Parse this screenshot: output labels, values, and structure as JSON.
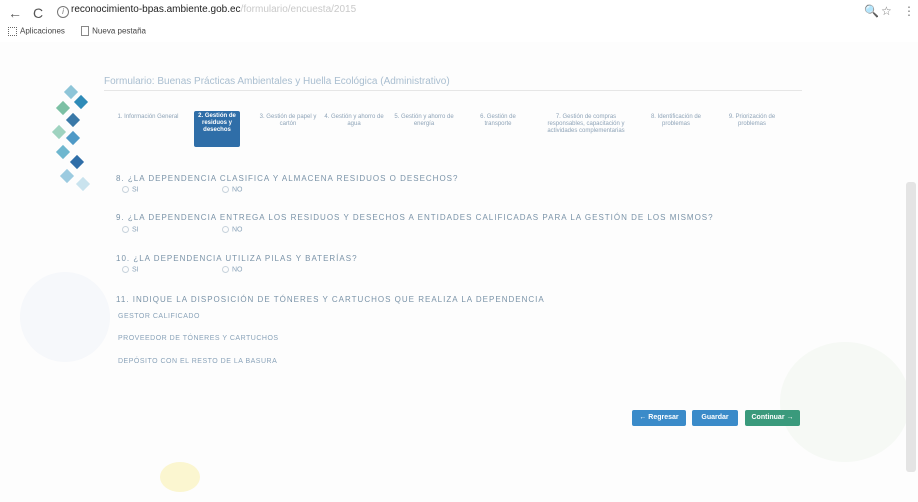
{
  "browser": {
    "url_host": "reconocimiento-bpas.ambiente.gob.ec",
    "url_path": "/formulario/encuesta/2015",
    "bookmarks": [
      "Aplicaciones",
      "Nueva pestaña"
    ]
  },
  "form": {
    "title": "Formulario: Buenas Prácticas Ambientales y Huella Ecológica (Administrativo)",
    "steps": [
      "1. Información General",
      "2. Gestión de residuos y desechos",
      "3. Gestión de papel y cartón",
      "4. Gestión y ahorro de agua",
      "5. Gestión y ahorro de energía",
      "6. Gestión de transporte",
      "7. Gestión de compras responsables, capacitación y actividades complementarias",
      "8. Identificación de problemas",
      "9. Priorización de problemas"
    ],
    "active_step_index": 1,
    "questions": [
      {
        "text": "8. ¿LA DEPENDENCIA CLASIFICA Y ALMACENA RESIDUOS O DESECHOS?",
        "opt_yes": "SI",
        "opt_no": "NO"
      },
      {
        "text": "9. ¿LA DEPENDENCIA ENTREGA LOS RESIDUOS Y DESECHOS A ENTIDADES CALIFICADAS PARA LA GESTIÓN DE LOS MISMOS?",
        "opt_yes": "SI",
        "opt_no": "NO"
      },
      {
        "text": "10. ¿LA DEPENDENCIA UTILIZA PILAS Y BATERÍAS?",
        "opt_yes": "SI",
        "opt_no": "NO"
      }
    ],
    "q11": {
      "text": "11. INDIQUE LA DISPOSICIÓN DE TÓNERES Y CARTUCHOS QUE REALIZA LA DEPENDENCIA",
      "options": [
        "GESTOR CALIFICADO",
        "PROVEEDOR DE TÓNERES Y CARTUCHOS",
        "DEPÓSITO CON EL RESTO DE LA BASURA"
      ]
    },
    "buttons": {
      "back": "← Regresar",
      "save": "Guardar",
      "next": "Continuar →"
    }
  },
  "colors": {
    "primary": "#2f6ea8",
    "button_blue": "#3b8bc9",
    "button_green": "#3a9a7c"
  }
}
